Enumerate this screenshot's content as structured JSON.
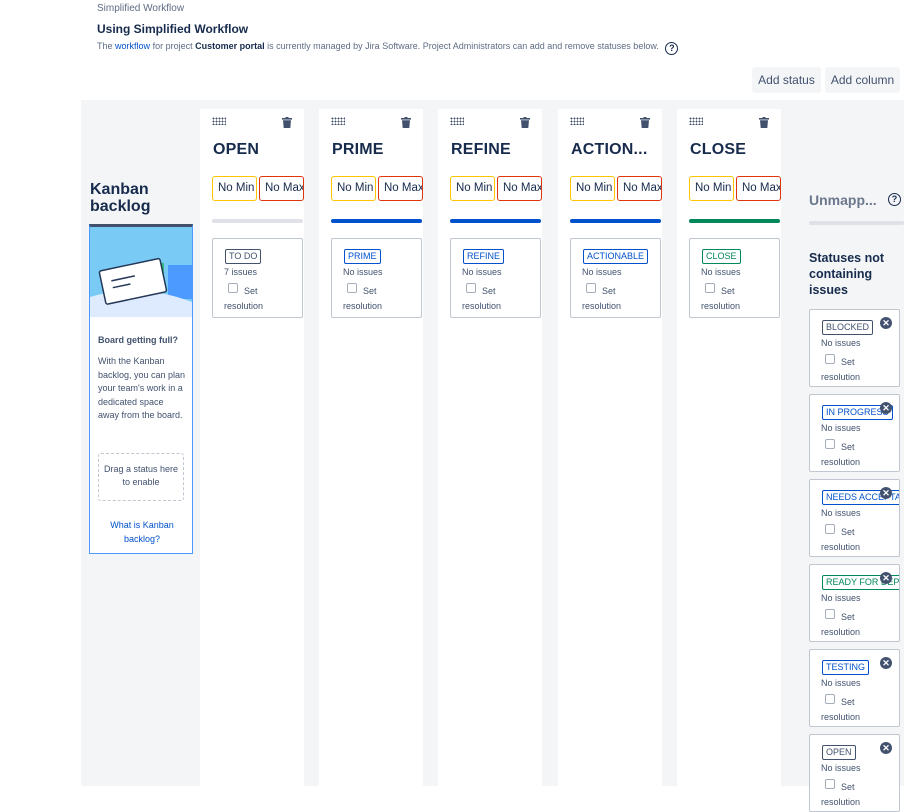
{
  "header": {
    "breadcrumb": "Simplified Workflow",
    "title": "Using Simplified Workflow",
    "desc_pre": "The",
    "desc_link": "workflow",
    "desc_mid": "for project",
    "desc_project": "Customer portal",
    "desc_post": "is currently managed by Jira Software. Project Administrators can add and remove statuses below.",
    "help_icon": "question-circle-icon"
  },
  "toolbar": {
    "add_status": "Add status",
    "add_column": "Add column"
  },
  "backlog": {
    "title": "Kanban backlog",
    "heading": "Board getting full?",
    "text": "With the Kanban backlog, you can plan your team's work in a dedicated space away from the board.",
    "dropzone": "Drag a status here to enable",
    "link": "What is Kanban backlog?"
  },
  "columns": [
    {
      "name": "OPEN",
      "min": "No Min",
      "max": "No Max",
      "bar_color": "#dfe1e6",
      "status": {
        "label": "TO DO",
        "color": "#42526e",
        "count": "7 issues",
        "resolution": "Set resolution"
      }
    },
    {
      "name": "PRIME",
      "min": "No Min",
      "max": "No Max",
      "bar_color": "#0052cc",
      "status": {
        "label": "PRIME",
        "color": "#0052cc",
        "count": "No issues",
        "resolution": "Set resolution"
      }
    },
    {
      "name": "REFINE",
      "min": "No Min",
      "max": "No Max",
      "bar_color": "#0052cc",
      "status": {
        "label": "REFINE",
        "color": "#0052cc",
        "count": "No issues",
        "resolution": "Set resolution"
      }
    },
    {
      "name": "ACTION...",
      "min": "No Min",
      "max": "No Max",
      "bar_color": "#0052cc",
      "status": {
        "label": "ACTIONABLE",
        "color": "#0052cc",
        "count": "No issues",
        "resolution": "Set resolution"
      }
    },
    {
      "name": "CLOSE",
      "min": "No Min",
      "max": "No Max",
      "bar_color": "#00875a",
      "status": {
        "label": "CLOSE",
        "color": "#00875a",
        "count": "No issues",
        "resolution": "Set resolution"
      }
    }
  ],
  "unmapped": {
    "title": "Unmapp...",
    "subtitle": "Statuses not containing issues",
    "statuses": [
      {
        "label": "BLOCKED",
        "color": "#42526e",
        "count": "No issues",
        "resolution": "Set resolution"
      },
      {
        "label": "IN PROGRESS",
        "color": "#0052cc",
        "count": "No issues",
        "resolution": "Set resolution"
      },
      {
        "label": "NEEDS ACCEPTANCE",
        "color": "#0052cc",
        "count": "No issues",
        "resolution": "Set resolution"
      },
      {
        "label": "READY FOR DEPLOYMENT",
        "color": "#00875a",
        "count": "No issues",
        "resolution": "Set resolution"
      },
      {
        "label": "TESTING",
        "color": "#0052cc",
        "count": "No issues",
        "resolution": "Set resolution"
      },
      {
        "label": "OPEN",
        "color": "#42526e",
        "count": "No issues",
        "resolution": "Set resolution"
      }
    ]
  }
}
